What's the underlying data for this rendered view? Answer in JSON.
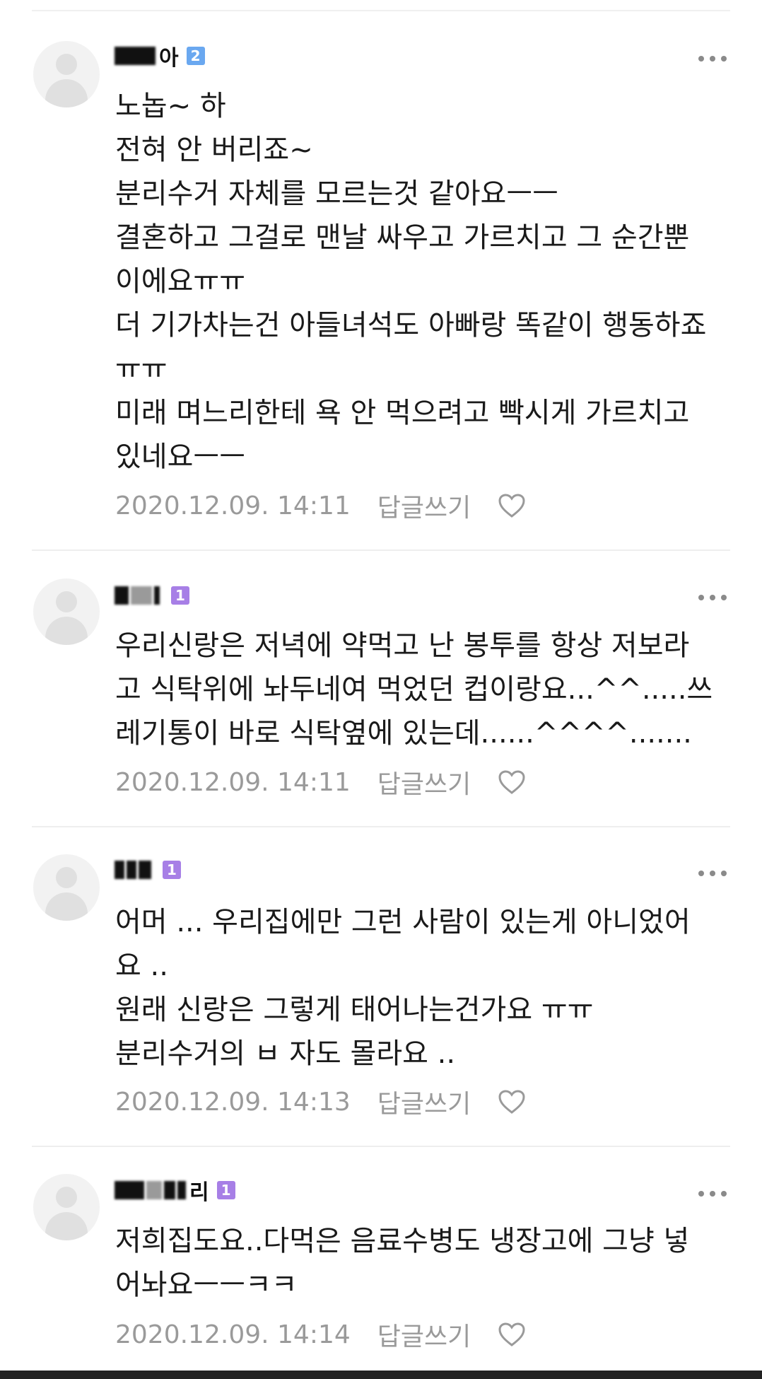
{
  "comments": [
    {
      "nick_tail": "아",
      "badge": "2",
      "lines": [
        "노놉~ 하",
        "전혀 안 버리죠~",
        "분리수거 자체를 모르는것 같아요ㅡㅡ",
        "결혼하고 그걸로 맨날 싸우고 가르치고 그 순간뿐",
        "이에요ㅠㅠ",
        "더 기가차는건 아들녀석도 아빠랑 똑같이 행동하죠",
        "ㅠㅠ",
        "미래 며느리한테 욕 안 먹으려고 빡시게 가르치고",
        "있네요ㅡㅡ"
      ],
      "date": "2020.12.09. 14:11",
      "reply": "답글쓰기"
    },
    {
      "nick_tail": "",
      "badge": "1",
      "lines": [
        "우리신랑은 저녁에 약먹고 난 봉투를 항상 저보라",
        "고 식탁위에 놔두네여 먹었던 컵이랑요...^^.....쓰",
        "레기통이 바로 식탁옆에 있는데......^^^^......."
      ],
      "date": "2020.12.09. 14:11",
      "reply": "답글쓰기"
    },
    {
      "nick_tail": "",
      "badge": "1",
      "lines": [
        "어머 ... 우리집에만 그런 사람이 있는게 아니었어",
        "요 ..",
        "원래 신랑은 그렇게 태어나는건가요 ㅠㅠ",
        "분리수거의 ㅂ 자도 몰라요 .."
      ],
      "date": "2020.12.09. 14:13",
      "reply": "답글쓰기"
    },
    {
      "nick_tail": "리",
      "badge": "1",
      "lines": [
        "저희집도요..다먹은 음료수병도 냉장고에 그냥 넣",
        "어놔요ㅡㅡㅋㅋ"
      ],
      "date": "2020.12.09. 14:14",
      "reply": "답글쓰기"
    }
  ],
  "colors": {
    "badge_level2": "#6aa8f0",
    "badge_level1": "#a77fe6",
    "text": "#1a1a1a",
    "meta": "#9a9a9a"
  },
  "icons": [
    "more-icon",
    "heart-icon",
    "avatar-icon"
  ]
}
